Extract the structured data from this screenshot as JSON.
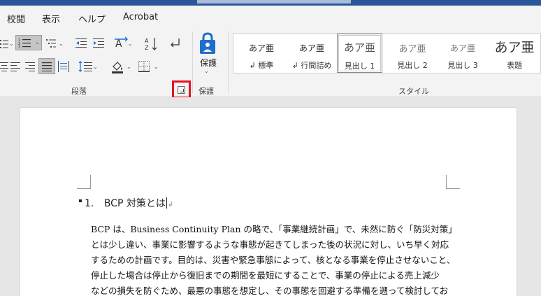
{
  "menu": {
    "tabs": [
      "校閲",
      "表示",
      "ヘルプ",
      "Acrobat"
    ]
  },
  "ribbon": {
    "groups": {
      "paragraph": "段落",
      "protect": "保護",
      "styles": "スタイル"
    },
    "protect_button": {
      "label": "保護",
      "icon": "lock-person-icon"
    },
    "styles": [
      {
        "preview": "あア亜",
        "name": "↲ 標準",
        "selected": false
      },
      {
        "preview": "あア亜",
        "name": "↲ 行間詰め",
        "selected": false
      },
      {
        "preview": "あア亜",
        "name": "見出し 1",
        "selected": true
      },
      {
        "preview": "あア亜",
        "name": "見出し 2",
        "selected": false
      },
      {
        "preview": "あア亜",
        "name": "見出し 3",
        "selected": false
      },
      {
        "preview": "あア亜",
        "name": "表題",
        "selected": false
      }
    ],
    "colors": {
      "accent": "#2b579a",
      "highlight": "#e81123",
      "protect_icon": "#1e6fc9"
    }
  },
  "document": {
    "heading": {
      "number": "1.",
      "text": "BCP 対策とは",
      "para_mark": "↲"
    },
    "body": [
      "BCP は、Business Continuity Plan  の略で、「事業継続計画」で、未然に防ぐ「防災対策」",
      "とは少し違い、事業に影響するような事態が起きてしまった後の状況に対し、いち早く対応",
      "するための計画です。目的は、災害や緊急事態によって、核となる事業を停止させないこと、",
      "停止した場合は停止から復旧までの期間を最短にすることで、事業の停止による売上減少",
      "などの損失を防ぐため、最悪の事態を想定し、その事態を回避する準備を遡って検討してお"
    ]
  }
}
